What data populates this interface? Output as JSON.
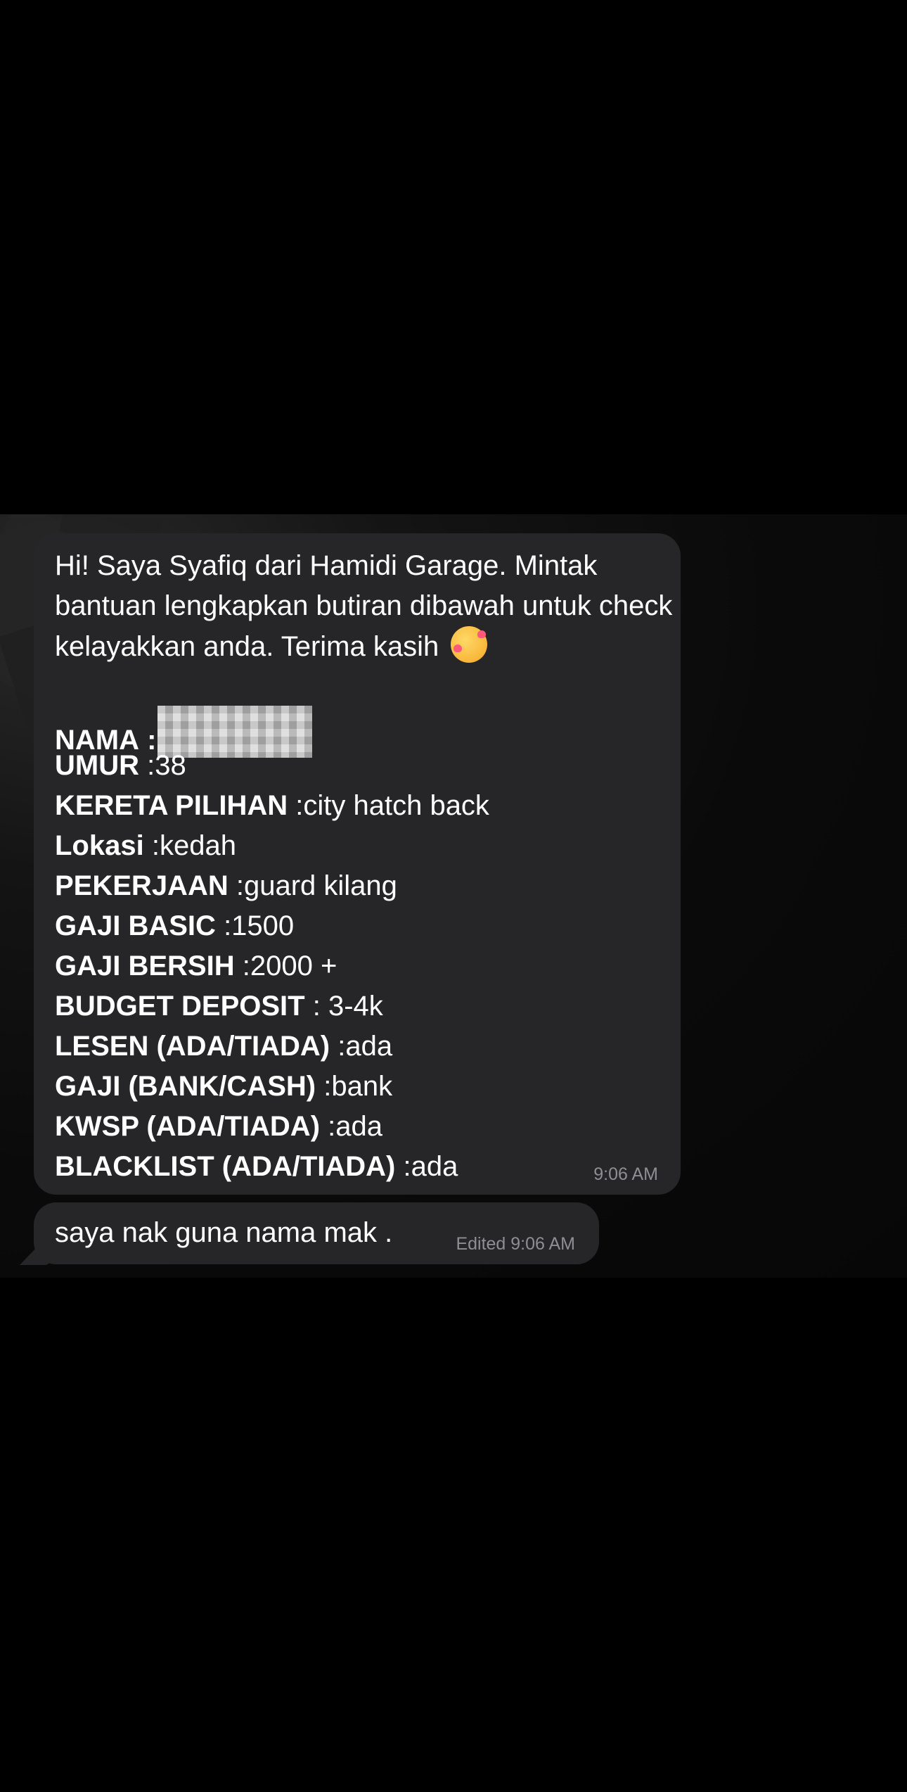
{
  "message_in": {
    "intro": "Hi! Saya Syafiq dari Hamidi Garage. Mintak bantuan lengkapkan butiran dibawah untuk check kelayakkan anda. Terima kasih",
    "emoji": "smiling-face-with-hearts-emoji",
    "fields": [
      {
        "label": "NAMA",
        "value": ""
      },
      {
        "label": "UMUR",
        "value": ":38"
      },
      {
        "label": "KERETA PILIHAN",
        "value": ":city hatch back"
      },
      {
        "label": "Lokasi",
        "value": ":kedah"
      },
      {
        "label": "PEKERJAAN",
        "value": ":guard kilang"
      },
      {
        "label": "GAJI BASIC",
        "value": ":1500"
      },
      {
        "label": "GAJI BERSIH",
        "value": ":2000 +"
      },
      {
        "label": "BUDGET DEPOSIT",
        "value": ": 3-4k"
      },
      {
        "label": "LESEN (ADA/TIADA)",
        "value": ":ada"
      },
      {
        "label": "GAJI (BANK/CASH)",
        "value": ":bank"
      },
      {
        "label": "KWSP (ADA/TIADA)",
        "value": ":ada"
      },
      {
        "label": "BLACKLIST (ADA/TIADA)",
        "value": ":ada"
      }
    ],
    "time": "9:06 AM"
  },
  "message_reply": {
    "text": "saya nak guna nama mak .",
    "time": "Edited 9:06 AM"
  },
  "colors": {
    "background": "#000000",
    "bubble": "#262628",
    "timestamp": "#8e8e93",
    "text": "#ffffff"
  }
}
